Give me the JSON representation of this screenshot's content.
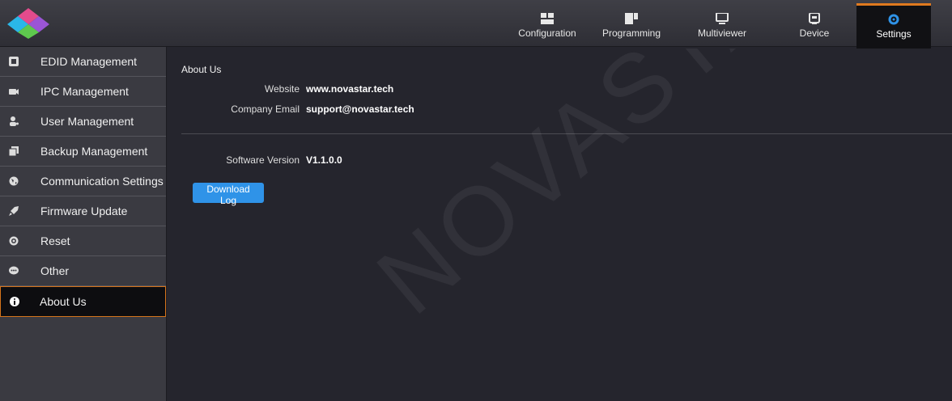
{
  "topbar": {
    "tabs": [
      {
        "label": "Configuration",
        "icon": "configuration-icon"
      },
      {
        "label": "Programming",
        "icon": "programming-icon"
      },
      {
        "label": "Multiviewer",
        "icon": "monitor-icon"
      },
      {
        "label": "Device",
        "icon": "device-icon"
      },
      {
        "label": "Settings",
        "icon": "gear-icon",
        "active": true
      }
    ],
    "accent_color": "#e07a1f"
  },
  "sidebar": {
    "items": [
      {
        "label": "EDID Management",
        "icon": "edid-icon"
      },
      {
        "label": "IPC Management",
        "icon": "ipc-icon"
      },
      {
        "label": "User Management",
        "icon": "user-icon"
      },
      {
        "label": "Backup Management",
        "icon": "backup-icon"
      },
      {
        "label": "Communication Settings",
        "icon": "globe-icon"
      },
      {
        "label": "Firmware Update",
        "icon": "rocket-icon"
      },
      {
        "label": "Reset",
        "icon": "reset-icon"
      },
      {
        "label": "Other",
        "icon": "chat-icon"
      },
      {
        "label": "About Us",
        "icon": "info-icon",
        "active": true
      }
    ]
  },
  "main": {
    "section_title": "About Us",
    "website_label": "Website",
    "website_value": "www.novastar.tech",
    "email_label": "Company Email",
    "email_value": "support@novastar.tech",
    "version_label": "Software Version",
    "version_value": "V1.1.0.0",
    "download_button": "Download Log",
    "button_color": "#2f93e8"
  },
  "watermark": "NOVASTAR TECH CO., LTD."
}
